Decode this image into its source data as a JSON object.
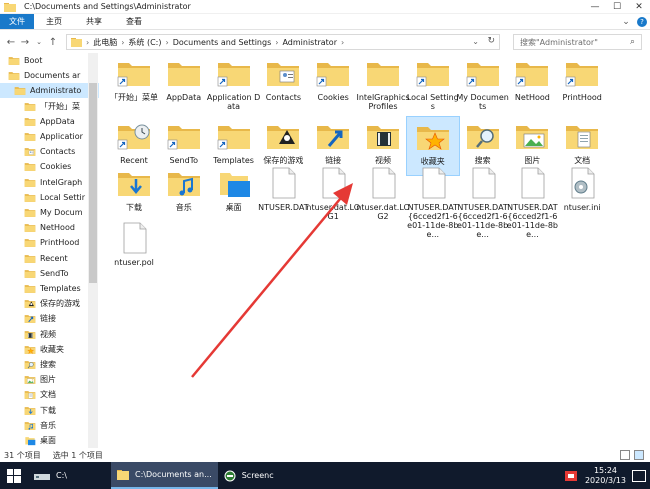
{
  "window": {
    "title": "C:\\Documents and Settings\\Administrator",
    "controls": [
      "—",
      "☐",
      "✕"
    ]
  },
  "ribbon": {
    "tabs": [
      "文件",
      "主页",
      "共享",
      "查看"
    ],
    "active_tab": "文件"
  },
  "address": {
    "crumbs": [
      "此电脑",
      "系统 (C:)",
      "Documents and Settings",
      "Administrator"
    ],
    "search_placeholder": "搜索\"Administrator\""
  },
  "nav": {
    "items": [
      {
        "label": "Boot",
        "type": "folder",
        "level": 1
      },
      {
        "label": "Documents ar",
        "type": "folder",
        "level": 1
      },
      {
        "label": "Administrato",
        "type": "folder",
        "level": 2,
        "selected": true
      },
      {
        "label": "「开始」菜",
        "type": "folder",
        "level": 3
      },
      {
        "label": "AppData",
        "type": "folder",
        "level": 3
      },
      {
        "label": "Applicatior",
        "type": "folder",
        "level": 3
      },
      {
        "label": "Contacts",
        "type": "contacts",
        "level": 3
      },
      {
        "label": "Cookies",
        "type": "folder",
        "level": 3
      },
      {
        "label": "IntelGraph",
        "type": "folder",
        "level": 3
      },
      {
        "label": "Local Settir",
        "type": "folder",
        "level": 3
      },
      {
        "label": "My Docum",
        "type": "folder",
        "level": 3
      },
      {
        "label": "NetHood",
        "type": "folder",
        "level": 3
      },
      {
        "label": "PrintHood",
        "type": "folder",
        "level": 3
      },
      {
        "label": "Recent",
        "type": "folder",
        "level": 3
      },
      {
        "label": "SendTo",
        "type": "folder",
        "level": 3
      },
      {
        "label": "Templates",
        "type": "folder",
        "level": 3
      },
      {
        "label": "保存的游戏",
        "type": "game",
        "level": 3
      },
      {
        "label": "链接",
        "type": "link",
        "level": 3
      },
      {
        "label": "视频",
        "type": "video",
        "level": 3
      },
      {
        "label": "收藏夹",
        "type": "star",
        "level": 3
      },
      {
        "label": "搜索",
        "type": "search",
        "level": 3
      },
      {
        "label": "图片",
        "type": "picture",
        "level": 3
      },
      {
        "label": "文档",
        "type": "doc",
        "level": 3
      },
      {
        "label": "下载",
        "type": "download",
        "level": 3
      },
      {
        "label": "音乐",
        "type": "music",
        "level": 3
      },
      {
        "label": "桌面",
        "type": "desktop",
        "level": 3
      }
    ]
  },
  "files": [
    {
      "name": "「开始」菜单",
      "type": "folder-shortcut"
    },
    {
      "name": "AppData",
      "type": "folder"
    },
    {
      "name": "Application Data",
      "type": "folder-shortcut"
    },
    {
      "name": "Contacts",
      "type": "contacts"
    },
    {
      "name": "Cookies",
      "type": "folder-shortcut"
    },
    {
      "name": "IntelGraphicsProfiles",
      "type": "folder"
    },
    {
      "name": "Local Settings",
      "type": "folder-shortcut"
    },
    {
      "name": "My Documents",
      "type": "folder-shortcut"
    },
    {
      "name": "NetHood",
      "type": "folder-shortcut"
    },
    {
      "name": "PrintHood",
      "type": "folder-shortcut"
    },
    {
      "name": "Recent",
      "type": "recent"
    },
    {
      "name": "SendTo",
      "type": "folder-shortcut"
    },
    {
      "name": "Templates",
      "type": "folder-shortcut"
    },
    {
      "name": "保存的游戏",
      "type": "game"
    },
    {
      "name": "链接",
      "type": "link"
    },
    {
      "name": "视频",
      "type": "video"
    },
    {
      "name": "收藏夹",
      "type": "star",
      "selected": true
    },
    {
      "name": "搜索",
      "type": "search"
    },
    {
      "name": "图片",
      "type": "picture"
    },
    {
      "name": "文档",
      "type": "doc"
    },
    {
      "name": "下载",
      "type": "download"
    },
    {
      "name": "音乐",
      "type": "music"
    },
    {
      "name": "桌面",
      "type": "desktop"
    },
    {
      "name": "NTUSER.DAT",
      "type": "file"
    },
    {
      "name": "ntuser.dat.LOG1",
      "type": "file"
    },
    {
      "name": "ntuser.dat.LOG2",
      "type": "file"
    },
    {
      "name": "NTUSER.DAT{6cced2f1-6e01-11de-8be...",
      "type": "file"
    },
    {
      "name": "NTUSER.DAT{6cced2f1-6e01-11de-8be...",
      "type": "file"
    },
    {
      "name": "NTUSER.DAT{6cced2f1-6e01-11de-8be...",
      "type": "file"
    },
    {
      "name": "ntuser.ini",
      "type": "settings"
    },
    {
      "name": "ntuser.pol",
      "type": "file"
    }
  ],
  "status": {
    "count": "31 个项目",
    "selection": "选中 1 个项目"
  },
  "taskbar": {
    "items": [
      {
        "label": "C:\\",
        "active": false
      },
      {
        "label": "C:\\Documents an...",
        "active": true
      },
      {
        "label": "Screenc",
        "active": false
      }
    ],
    "time": "15:24",
    "date": "2020/3/13"
  },
  "colors": {
    "accent": "#1979ca",
    "selection": "#cce8ff",
    "folder": "#f8d775",
    "folder_dark": "#e8b84a",
    "arrow": "#e53935",
    "taskbar": "#101a2c"
  }
}
